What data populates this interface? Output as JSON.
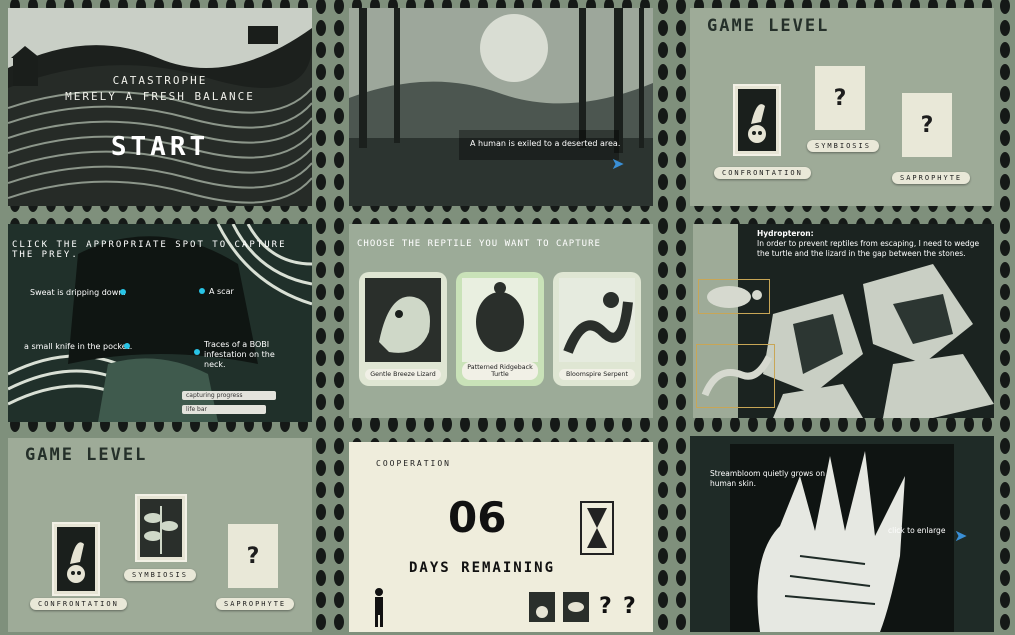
{
  "start_screen": {
    "line1": "CATASTROPHE",
    "line2": "MERELY A FRESH BALANCE",
    "start_label": "START"
  },
  "exile_scene": {
    "caption": "A human is exiled to a deserted area.",
    "next_icon": "chevron-right-icon"
  },
  "game_level_1": {
    "title": "GAME LEVEL",
    "cards": [
      {
        "label": "CONFRONTATION",
        "revealed": true
      },
      {
        "label": "SYMBIOSIS",
        "revealed": false,
        "glyph": "?"
      },
      {
        "label": "SAPROPHYTE",
        "revealed": false,
        "glyph": "?"
      }
    ]
  },
  "capture_prey": {
    "heading": "CLICK THE APPROPRIATE SPOT TO CAPTURE THE PREY.",
    "hints": [
      "Sweat is dripping down.",
      "A scar",
      "a small knife in the pocket.",
      "Traces of a BOBI infestation on the neck."
    ],
    "progress_label": "capturing progress",
    "life_label": "life bar"
  },
  "choose_reptile": {
    "heading": "CHOOSE THE REPTILE YOU WANT TO CAPTURE",
    "reptiles": [
      "Gentle Breeze Lizard",
      "Patterned Ridgeback Turtle",
      "Bloomspire Serpent"
    ]
  },
  "hydropteron": {
    "title": "Hydropteron:",
    "text": "In order to prevent reptiles from escaping, I need to wedge the turtle and the lizard in the gap between the stones."
  },
  "game_level_2": {
    "title": "GAME LEVEL",
    "cards": [
      {
        "label": "CONFRONTATION",
        "revealed": true
      },
      {
        "label": "SYMBIOSIS",
        "revealed": true
      },
      {
        "label": "SAPROPHYTE",
        "revealed": false,
        "glyph": "?"
      }
    ]
  },
  "cooperation": {
    "title": "COOPERATION",
    "days": "06",
    "days_label": "DAYS REMAINING",
    "unknown_glyph": "?"
  },
  "streambloom": {
    "text": "Streambloom quietly grows on human skin.",
    "enlarge_label": "click to enlarge"
  },
  "colors": {
    "background": "#7f907c",
    "panel_sage": "#9eab98",
    "cream": "#efeddc",
    "accent_blue": "#3a8fd6",
    "hotspot_cyan": "#28c4e6"
  }
}
